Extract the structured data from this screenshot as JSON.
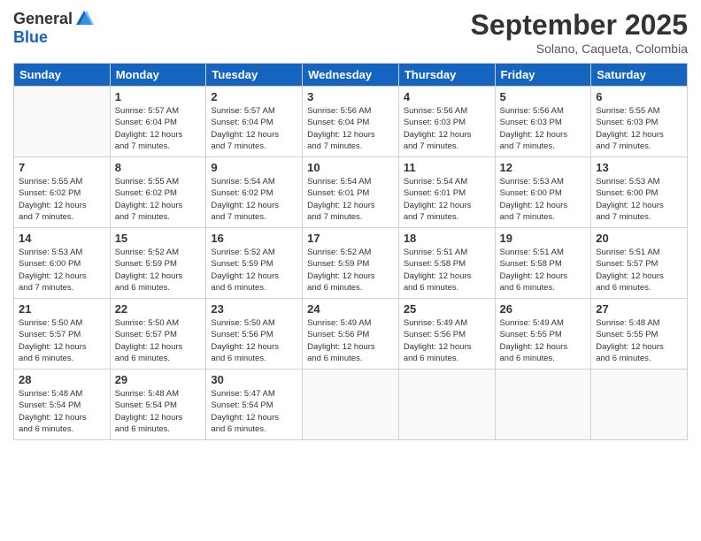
{
  "logo": {
    "general": "General",
    "blue": "Blue"
  },
  "title": "September 2025",
  "location": "Solano, Caqueta, Colombia",
  "days_header": [
    "Sunday",
    "Monday",
    "Tuesday",
    "Wednesday",
    "Thursday",
    "Friday",
    "Saturday"
  ],
  "weeks": [
    [
      {
        "day": "",
        "info": ""
      },
      {
        "day": "1",
        "info": "Sunrise: 5:57 AM\nSunset: 6:04 PM\nDaylight: 12 hours\nand 7 minutes."
      },
      {
        "day": "2",
        "info": "Sunrise: 5:57 AM\nSunset: 6:04 PM\nDaylight: 12 hours\nand 7 minutes."
      },
      {
        "day": "3",
        "info": "Sunrise: 5:56 AM\nSunset: 6:04 PM\nDaylight: 12 hours\nand 7 minutes."
      },
      {
        "day": "4",
        "info": "Sunrise: 5:56 AM\nSunset: 6:03 PM\nDaylight: 12 hours\nand 7 minutes."
      },
      {
        "day": "5",
        "info": "Sunrise: 5:56 AM\nSunset: 6:03 PM\nDaylight: 12 hours\nand 7 minutes."
      },
      {
        "day": "6",
        "info": "Sunrise: 5:55 AM\nSunset: 6:03 PM\nDaylight: 12 hours\nand 7 minutes."
      }
    ],
    [
      {
        "day": "7",
        "info": "Sunrise: 5:55 AM\nSunset: 6:02 PM\nDaylight: 12 hours\nand 7 minutes."
      },
      {
        "day": "8",
        "info": "Sunrise: 5:55 AM\nSunset: 6:02 PM\nDaylight: 12 hours\nand 7 minutes."
      },
      {
        "day": "9",
        "info": "Sunrise: 5:54 AM\nSunset: 6:02 PM\nDaylight: 12 hours\nand 7 minutes."
      },
      {
        "day": "10",
        "info": "Sunrise: 5:54 AM\nSunset: 6:01 PM\nDaylight: 12 hours\nand 7 minutes."
      },
      {
        "day": "11",
        "info": "Sunrise: 5:54 AM\nSunset: 6:01 PM\nDaylight: 12 hours\nand 7 minutes."
      },
      {
        "day": "12",
        "info": "Sunrise: 5:53 AM\nSunset: 6:00 PM\nDaylight: 12 hours\nand 7 minutes."
      },
      {
        "day": "13",
        "info": "Sunrise: 5:53 AM\nSunset: 6:00 PM\nDaylight: 12 hours\nand 7 minutes."
      }
    ],
    [
      {
        "day": "14",
        "info": "Sunrise: 5:53 AM\nSunset: 6:00 PM\nDaylight: 12 hours\nand 7 minutes."
      },
      {
        "day": "15",
        "info": "Sunrise: 5:52 AM\nSunset: 5:59 PM\nDaylight: 12 hours\nand 6 minutes."
      },
      {
        "day": "16",
        "info": "Sunrise: 5:52 AM\nSunset: 5:59 PM\nDaylight: 12 hours\nand 6 minutes."
      },
      {
        "day": "17",
        "info": "Sunrise: 5:52 AM\nSunset: 5:59 PM\nDaylight: 12 hours\nand 6 minutes."
      },
      {
        "day": "18",
        "info": "Sunrise: 5:51 AM\nSunset: 5:58 PM\nDaylight: 12 hours\nand 6 minutes."
      },
      {
        "day": "19",
        "info": "Sunrise: 5:51 AM\nSunset: 5:58 PM\nDaylight: 12 hours\nand 6 minutes."
      },
      {
        "day": "20",
        "info": "Sunrise: 5:51 AM\nSunset: 5:57 PM\nDaylight: 12 hours\nand 6 minutes."
      }
    ],
    [
      {
        "day": "21",
        "info": "Sunrise: 5:50 AM\nSunset: 5:57 PM\nDaylight: 12 hours\nand 6 minutes."
      },
      {
        "day": "22",
        "info": "Sunrise: 5:50 AM\nSunset: 5:57 PM\nDaylight: 12 hours\nand 6 minutes."
      },
      {
        "day": "23",
        "info": "Sunrise: 5:50 AM\nSunset: 5:56 PM\nDaylight: 12 hours\nand 6 minutes."
      },
      {
        "day": "24",
        "info": "Sunrise: 5:49 AM\nSunset: 5:56 PM\nDaylight: 12 hours\nand 6 minutes."
      },
      {
        "day": "25",
        "info": "Sunrise: 5:49 AM\nSunset: 5:56 PM\nDaylight: 12 hours\nand 6 minutes."
      },
      {
        "day": "26",
        "info": "Sunrise: 5:49 AM\nSunset: 5:55 PM\nDaylight: 12 hours\nand 6 minutes."
      },
      {
        "day": "27",
        "info": "Sunrise: 5:48 AM\nSunset: 5:55 PM\nDaylight: 12 hours\nand 6 minutes."
      }
    ],
    [
      {
        "day": "28",
        "info": "Sunrise: 5:48 AM\nSunset: 5:54 PM\nDaylight: 12 hours\nand 6 minutes."
      },
      {
        "day": "29",
        "info": "Sunrise: 5:48 AM\nSunset: 5:54 PM\nDaylight: 12 hours\nand 6 minutes."
      },
      {
        "day": "30",
        "info": "Sunrise: 5:47 AM\nSunset: 5:54 PM\nDaylight: 12 hours\nand 6 minutes."
      },
      {
        "day": "",
        "info": ""
      },
      {
        "day": "",
        "info": ""
      },
      {
        "day": "",
        "info": ""
      },
      {
        "day": "",
        "info": ""
      }
    ]
  ]
}
